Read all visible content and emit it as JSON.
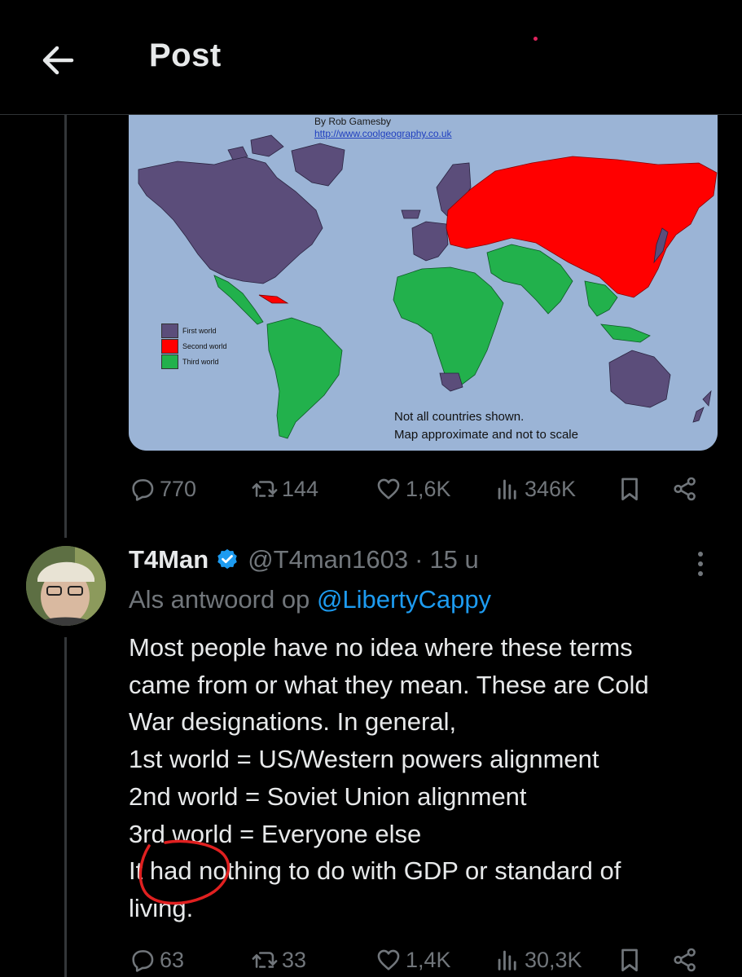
{
  "header": {
    "title": "Post",
    "back_icon": "arrow-left-icon"
  },
  "map": {
    "credit_author": "By Rob Gamesby",
    "credit_url": "http://www.coolgeography.co.uk",
    "legend": [
      {
        "label": "First world",
        "color": "#5b4d7a"
      },
      {
        "label": "Second world",
        "color": "#ff0000"
      },
      {
        "label": "Third world",
        "color": "#22b14c"
      }
    ],
    "note_line1": "Not all countries shown.",
    "note_line2": "Map approximate and not to scale",
    "ocean_color": "#9bb4d6"
  },
  "post_actions": {
    "replies": "770",
    "reposts": "144",
    "likes": "1,6K",
    "views": "346K"
  },
  "reply": {
    "name": "T4Man",
    "handle": "@T4man1603",
    "separator": "·",
    "time": "15 u",
    "reply_to_prefix": "Als antwoord op",
    "reply_to_mention": "@LibertyCappy",
    "body_lines": [
      "Most people have no idea where these terms",
      "came from or what they mean. These are Cold",
      "War designations. In general,",
      "1st world = US/Western powers alignment",
      "2nd world = Soviet Union alignment",
      "3rd world = Everyone else",
      "It had nothing to do with GDP or standard of",
      "living."
    ],
    "actions": {
      "replies": "63",
      "reposts": "33",
      "likes": "1,4K",
      "views": "30,3K"
    }
  },
  "colors": {
    "accent": "#1d9bf0",
    "muted": "#71767b",
    "annotation": "#e02020"
  }
}
